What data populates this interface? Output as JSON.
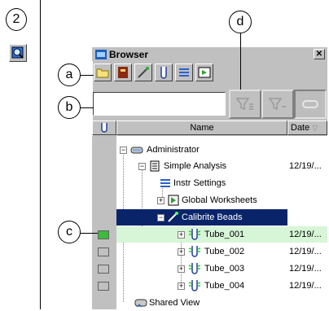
{
  "step": {
    "number": "2"
  },
  "window": {
    "title": "Browser",
    "close": "✕"
  },
  "callouts": {
    "a": "a",
    "b": "b",
    "c": "c",
    "d": "d"
  },
  "search": {
    "value": "",
    "placeholder": ""
  },
  "table": {
    "col_name": "Name",
    "col_date": "Date",
    "sort_glyph": "▽"
  },
  "tree": [
    {
      "label": "Administrator",
      "date": ""
    },
    {
      "label": "Simple Analysis",
      "date": "12/19/..."
    },
    {
      "label": "Instr Settings",
      "date": ""
    },
    {
      "label": "Global Worksheets",
      "date": ""
    },
    {
      "label": "Calibrite Beads",
      "date": ""
    },
    {
      "label": "Tube_001",
      "date": "12/19/..."
    },
    {
      "label": "Tube_002",
      "date": "12/19/..."
    },
    {
      "label": "Tube_003",
      "date": "12/19/..."
    },
    {
      "label": "Tube_004",
      "date": "12/19/..."
    },
    {
      "label": "Shared View",
      "date": ""
    }
  ],
  "colors": {
    "selection": "#0a246a",
    "highlight": "#d7f5d7",
    "window": "#c0c0c0",
    "flag_on": "#3bbd3b"
  },
  "icons": [
    "folder-icon",
    "book-icon",
    "beads-icon",
    "tube-icon",
    "settings-icon",
    "worksheet-icon",
    "filter-icon",
    "flag-icon"
  ]
}
